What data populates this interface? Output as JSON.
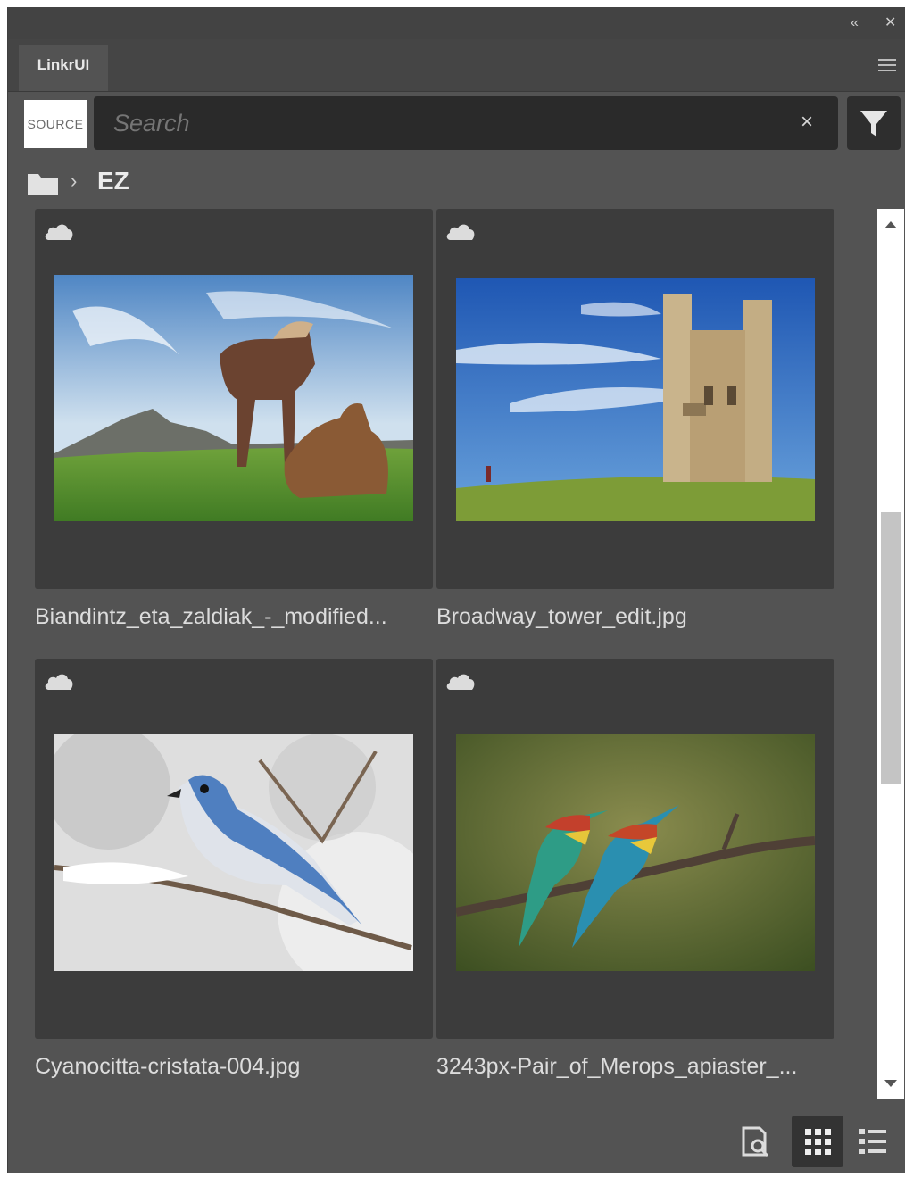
{
  "panel": {
    "tab_label": "LinkrUI"
  },
  "toolbar": {
    "source_label": "SOURCE",
    "search_placeholder": "Search",
    "clear_symbol": "×"
  },
  "breadcrumb": {
    "separator": "›",
    "current": "EZ"
  },
  "files": [
    {
      "name": "Biandintz_eta_zaldiak_-_modified...",
      "cloud_icon": "cloud-icon"
    },
    {
      "name": "Broadway_tower_edit.jpg",
      "cloud_icon": "cloud-icon"
    },
    {
      "name": "Cyanocitta-cristata-004.jpg",
      "cloud_icon": "cloud-icon"
    },
    {
      "name": "3243px-Pair_of_Merops_apiaster_...",
      "cloud_icon": "cloud-icon"
    }
  ],
  "view": {
    "active_mode": "grid"
  },
  "colors": {
    "panel_bg": "#535353",
    "card_bg": "#3c3c3c",
    "search_bg": "#2a2a2a"
  }
}
